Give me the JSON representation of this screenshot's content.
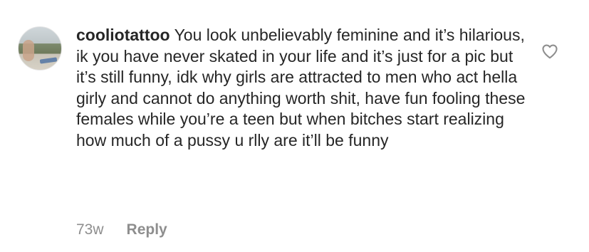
{
  "comment": {
    "username": "cooliotattoo",
    "text": "You look unbelievably feminine and it’s hilarious, ik you have never skated in your life and it’s just for a pic but it’s still funny, idk why girls are attracted to men who act hella girly and cannot do anything worth shit, have fun fooling these females while you’re a teen but when bitches start realizing how much of a pussy u rlly are it’ll be funny",
    "time": "73w",
    "reply_label": "Reply",
    "like_icon": "heart-outline-icon"
  },
  "colors": {
    "text": "#262626",
    "muted": "#8e8e8e",
    "background": "#ffffff"
  }
}
